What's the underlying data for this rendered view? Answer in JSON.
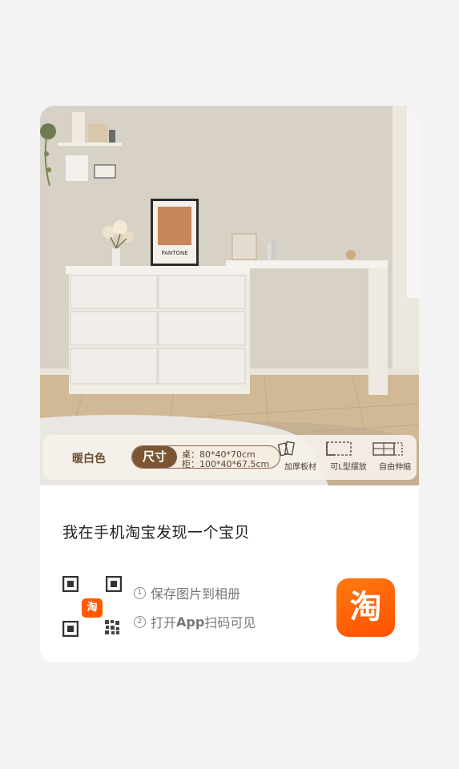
{
  "product_image": {
    "poster_text": "PANTONE",
    "color_name": "暖白色",
    "size_tag": "尺寸",
    "size_desk": "桌：80*40*70cm",
    "size_cabinet": "柜：100*40*67.5cm",
    "features": [
      {
        "label": "加厚板材",
        "icon": "board-icon"
      },
      {
        "label": "可L型摆放",
        "icon": "l-shape-icon"
      },
      {
        "label": "自由伸缩",
        "icon": "extend-icon"
      }
    ]
  },
  "share": {
    "headline": "我在手机淘宝发现一个宝贝",
    "qr_badge": "淘",
    "step1_num": "1",
    "step1_text": "保存图片到相册",
    "step2_num": "2",
    "step2_prefix": "打开",
    "step2_bold": "App",
    "step2_suffix": "扫码可见",
    "app_logo_text": "淘"
  },
  "colors": {
    "brand_orange": "#ff5000",
    "accent_brown": "#7a5634",
    "background": "#f3f3f3"
  }
}
